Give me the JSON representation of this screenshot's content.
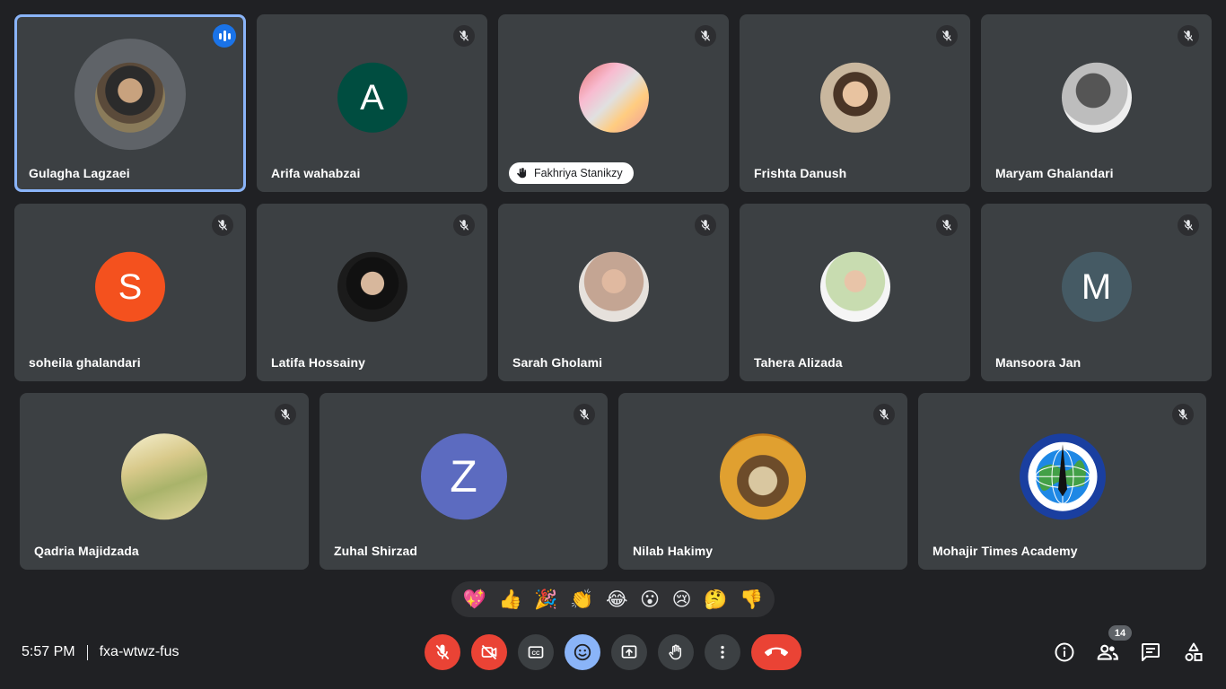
{
  "participants_row1": [
    {
      "name": "Gulagha Lagzaei",
      "avatar": "photo",
      "speaking": true
    },
    {
      "name": "Arifa wahabzai",
      "avatar": "initial",
      "initial": "A",
      "color": "#004d40"
    },
    {
      "name": "Fakhriya Stanikzy",
      "avatar": "photo",
      "pinned_style": "pill"
    },
    {
      "name": "Frishta Danush",
      "avatar": "photo"
    },
    {
      "name": "Maryam Ghalandari",
      "avatar": "photo"
    }
  ],
  "participants_row2": [
    {
      "name": "soheila ghalandari",
      "avatar": "initial",
      "initial": "S",
      "color": "#f4511e"
    },
    {
      "name": "Latifa Hossainy",
      "avatar": "photo"
    },
    {
      "name": "Sarah Gholami",
      "avatar": "photo"
    },
    {
      "name": "Tahera Alizada",
      "avatar": "photo"
    },
    {
      "name": "Mansoora Jan",
      "avatar": "initial",
      "initial": "M",
      "color": "#455a64"
    }
  ],
  "participants_row3": [
    {
      "name": "Qadria Majidzada",
      "avatar": "photo"
    },
    {
      "name": "Zuhal Shirzad",
      "avatar": "initial",
      "initial": "Z",
      "color": "#5c6bc0"
    },
    {
      "name": "Nilab Hakimy",
      "avatar": "photo"
    },
    {
      "name": "Mohajir Times Academy",
      "avatar": "logo"
    }
  ],
  "reactions": [
    "💖",
    "👍",
    "🎉",
    "👏",
    "😂",
    "😮",
    "😢",
    "🤔",
    "👎"
  ],
  "meeting": {
    "time": "5:57 PM",
    "code": "fxa-wtwz-fus"
  },
  "participant_count": "14",
  "colors": {
    "background": "#202124",
    "tile": "#3c4043",
    "active_border": "#8ab4f8",
    "danger": "#ea4335",
    "accent": "#8ab4f8"
  },
  "controls": [
    "mic-off-icon",
    "camera-off-icon",
    "captions-icon",
    "emoji-icon",
    "present-icon",
    "raise-hand-icon",
    "more-options-icon",
    "hang-up-icon"
  ],
  "right_controls": [
    "info-icon",
    "people-icon",
    "chat-icon",
    "activities-icon"
  ]
}
